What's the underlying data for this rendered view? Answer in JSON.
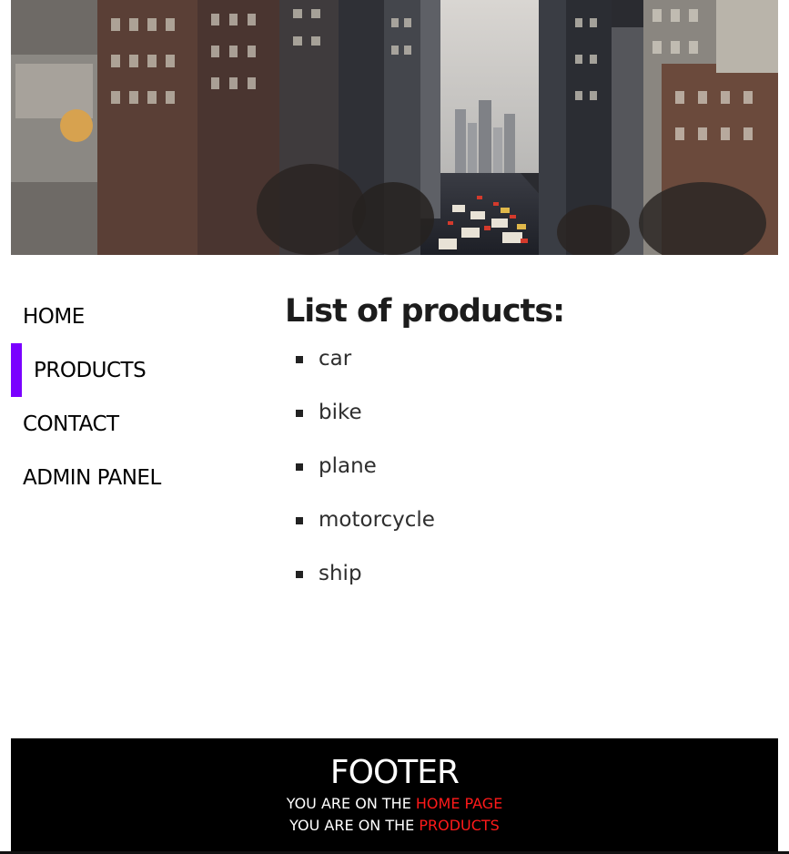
{
  "nav": {
    "items": [
      {
        "label": "HOME",
        "active": false
      },
      {
        "label": "PRODUCTS",
        "active": true
      },
      {
        "label": "CONTACT",
        "active": false
      },
      {
        "label": "ADMIN PANEL",
        "active": false
      }
    ]
  },
  "main": {
    "heading": "List of products:",
    "products": [
      "car",
      "bike",
      "plane",
      "motorcycle",
      "ship"
    ]
  },
  "footer": {
    "title": "FOOTER",
    "line1_prefix": "YOU ARE ON THE",
    "line1_highlight": "HOME PAGE",
    "line2_prefix": "YOU ARE ON THE",
    "line2_highlight": "PRODUCTS"
  },
  "colors": {
    "accent": "#7a00ff",
    "footer_bg": "#000000",
    "footer_highlight": "#ff1a1a"
  }
}
